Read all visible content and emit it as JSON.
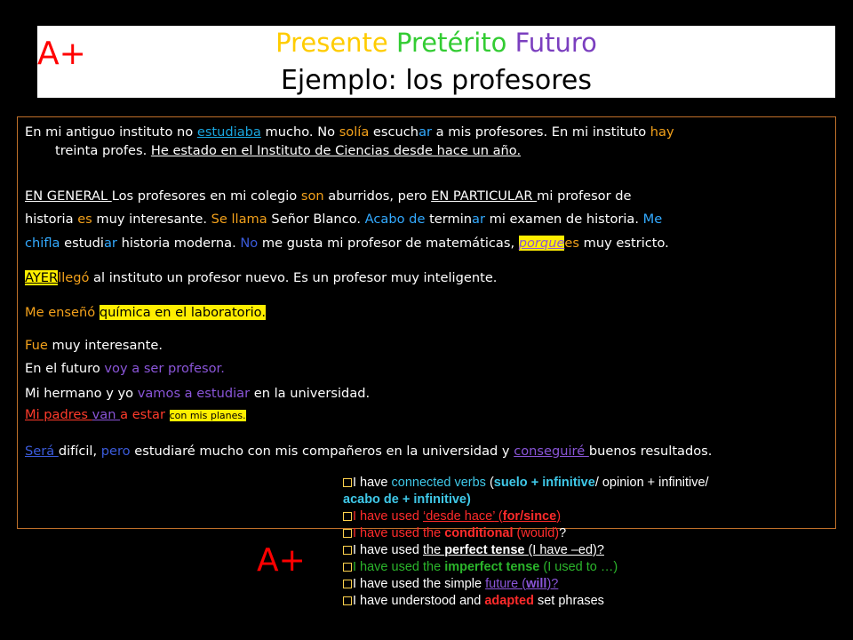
{
  "header": {
    "word_presente": "Presente",
    "word_preterito": "Pretérito",
    "word_futuro": "Futuro",
    "subtitle": "Ejemplo: los profesores",
    "grade_top": "A+"
  },
  "paragraph": {
    "l1_a": "En mi antiguo instituto no ",
    "l1_b": "estudiaba",
    "l1_c": " mucho. No ",
    "l1_d": "solía",
    "l1_e": "  escuch",
    "l1_f": "ar",
    "l1_g": " a mis profesores. En mi instituto ",
    "l1_h": "hay",
    "l2_a": "treinta profes. ",
    "l2_b": "He  estado en el Instituto de Ciencias  desde hace  un año.",
    "l3_a": "EN GENERAL ",
    "l3_b": "Los profesores en mi colegio ",
    "l3_c": "son",
    "l3_d": " aburridos, pero ",
    "l3_e": "EN PARTICULAR ",
    "l3_f": "mi profesor de",
    "l4_a": "historia ",
    "l4_b": "es",
    "l4_c": " muy interesante. ",
    "l4_d": "Se llama",
    "l4_e": " Señor Blanco. ",
    "l4_f": "Acabo de",
    "l4_g": "  termin",
    "l4_h": "ar",
    "l4_i": " mi examen de historia. ",
    "l4_j": "Me",
    "l5_a": "chifla",
    "l5_b": "  estudi",
    "l5_c": "ar",
    "l5_d": "  historia moderna.  ",
    "l5_e": "No",
    "l5_f": " me gusta",
    "l5_g": " mi profesor de matemáticas, ",
    "l5_h": "porque",
    "l5_i": "es",
    "l5_j": " muy estricto.",
    "l6_a": "AYER",
    "l6_b": "llegó",
    "l6_c": " al instituto un profesor nuevo. Es un profesor muy inteligente.",
    "l7_a": "Me enseñó ",
    "l7_b": "química en el laboratorio.",
    "l8_a": "Fue",
    "l8_b": " muy interesante.",
    "l9_a": "En el futuro  ",
    "l9_b": "voy a ser profesor.",
    "l10_a": "Mi hermano y yo ",
    "l10_b": "vamos a estudiar",
    "l10_c": " en la universidad.",
    "l11_a": "Mi padres ",
    "l11_b": "van ",
    "l11_c": "a estar ",
    "l11_d": "con mis planes.",
    "l12_a": "Será ",
    "l12_b": "difícil, ",
    "l12_c": "pero",
    "l12_d": " estudiaré mucho con mis compañeros en la universidad y ",
    "l12_e": "conseguiré ",
    "l12_f": "buenos resultados."
  },
  "grade_bottom": "A+",
  "checklist": {
    "c1_a": "I have ",
    "c1_b": "connected verbs",
    "c1_c": " (",
    "c1_d": "suelo + infinitive",
    "c1_e": "/ opinion + infinitive/",
    "c1_f": "acabo de + infinitive)",
    "c2_a": "I have used ",
    "c2_b": "‘desde hace’",
    "c2_c": " (",
    "c2_d": "for/since",
    "c2_e": ")",
    "c3_a": "I have used the ",
    "c3_b": "conditional",
    "c3_c": " (would)",
    "c3_d": "?",
    "c4_a": "I have used ",
    "c4_b": "the ",
    "c4_c": "perfect tense",
    "c4_d": " (I have –ed)?",
    "c5_a": "I have used the ",
    "c5_b": "imperfect tense",
    "c5_c": "  (I used to …)",
    "c6_a": "I have used the simple ",
    "c6_b": "future (",
    "c6_c": "will",
    "c6_d": ")?",
    "c7_a": "I have understood and ",
    "c7_b": "adapted",
    "c7_c": " set phrases"
  },
  "colors": {
    "background": "#000000",
    "presente": "#ffcc00",
    "preterito": "#33cc33",
    "futuro": "#7b3fbf",
    "grade": "#ff0000",
    "border": "#c0702a",
    "highlight": "#ffee00"
  }
}
